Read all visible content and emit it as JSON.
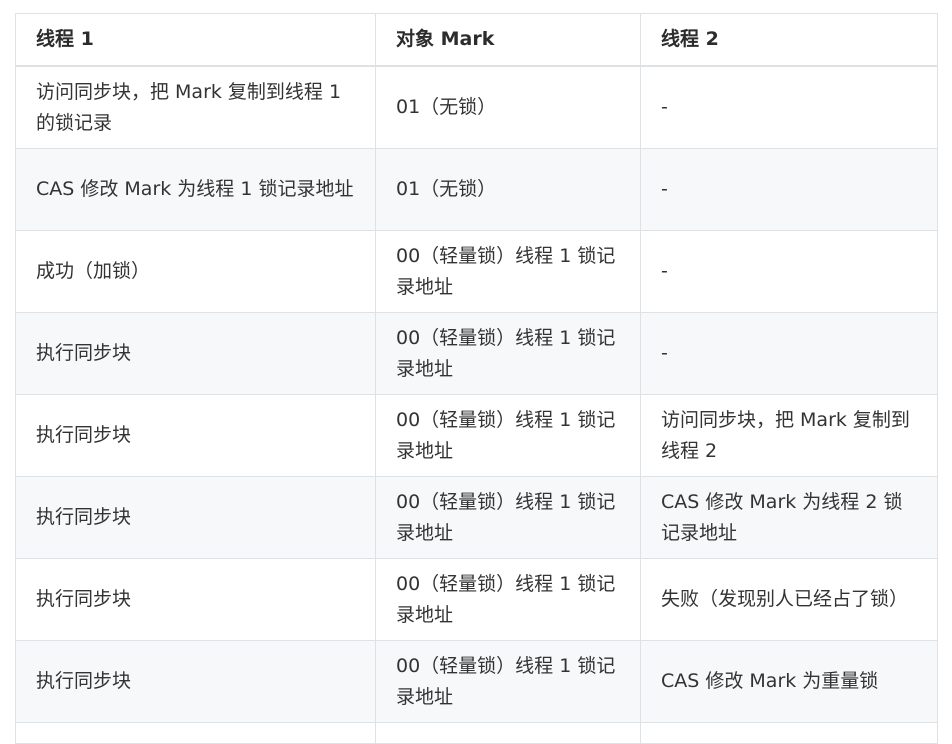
{
  "table": {
    "headers": [
      "线程 1",
      "对象 Mark",
      "线程 2"
    ],
    "rows": [
      [
        "访问同步块，把 Mark 复制到线程 1 的锁记录",
        "01（无锁）",
        "-"
      ],
      [
        "CAS 修改 Mark 为线程 1 锁记录地址",
        "01（无锁）",
        "-"
      ],
      [
        "成功（加锁）",
        "00（轻量锁）线程 1 锁记录地址",
        "-"
      ],
      [
        "执行同步块",
        "00（轻量锁）线程 1 锁记录地址",
        "-"
      ],
      [
        "执行同步块",
        "00（轻量锁）线程 1 锁记录地址",
        "访问同步块，把 Mark 复制到线程 2"
      ],
      [
        "执行同步块",
        "00（轻量锁）线程 1 锁记录地址",
        "CAS 修改 Mark 为线程 2 锁记录地址"
      ],
      [
        "执行同步块",
        "00（轻量锁）线程 1 锁记录地址",
        "失败（发现别人已经占了锁）"
      ],
      [
        "执行同步块",
        "00（轻量锁）线程 1 锁记录地址",
        "CAS 修改 Mark 为重量锁"
      ]
    ]
  }
}
